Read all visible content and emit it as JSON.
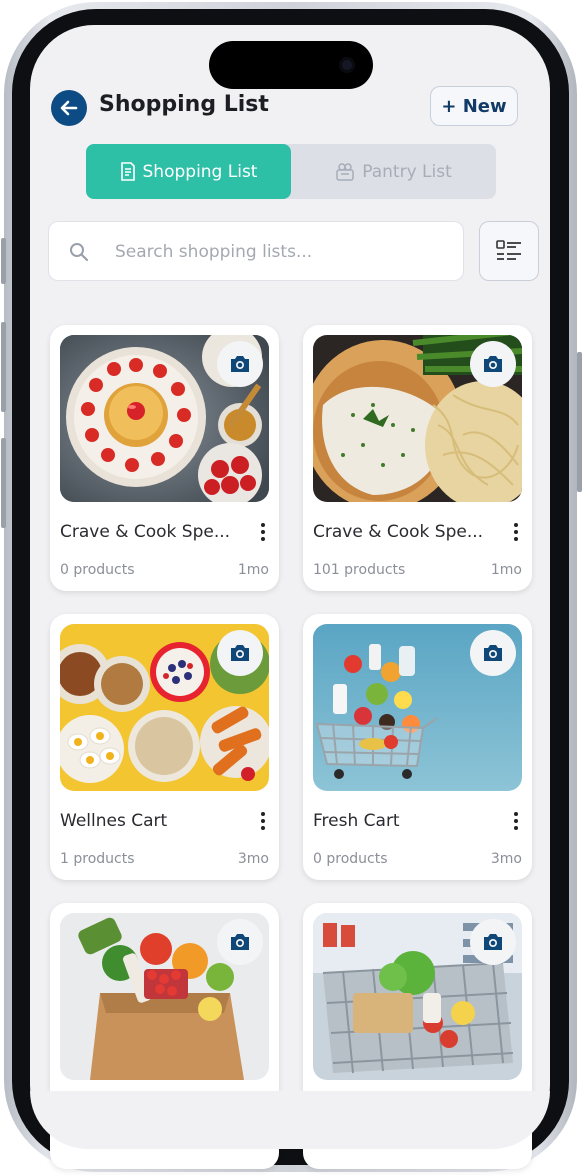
{
  "header": {
    "title": "Shopping List",
    "new_button": "+ New"
  },
  "tabs": [
    {
      "label": "Shopping List",
      "active": true
    },
    {
      "label": "Pantry List",
      "active": false
    }
  ],
  "search": {
    "placeholder": "Search shopping lists...",
    "value": ""
  },
  "colors": {
    "accent": "#2ebfa7",
    "brand_blue": "#0d4b84",
    "background": "#f1f1f4"
  },
  "icons": [
    "back-arrow-icon",
    "document-list-icon",
    "pantry-icon",
    "search-icon",
    "list-view-icon",
    "camera-icon",
    "more-vertical-icon"
  ],
  "lists": [
    {
      "name": "Crave & Cook Spe...",
      "count": "0 products",
      "age": "1mo",
      "image": "pancake breakfast"
    },
    {
      "name": "Crave & Cook Spe...",
      "count": "101 products",
      "age": "1mo",
      "image": "chicken with pasta"
    },
    {
      "name": "Wellnes Cart",
      "count": "1 products",
      "age": "3mo",
      "image": "healthy bowls"
    },
    {
      "name": "Fresh Cart",
      "count": "0 products",
      "age": "3mo",
      "image": "grocery cart flying"
    },
    {
      "name": "",
      "count": "",
      "age": "",
      "image": "grocery paper bag"
    },
    {
      "name": "",
      "count": "",
      "age": "",
      "image": "supermarket cart"
    }
  ]
}
